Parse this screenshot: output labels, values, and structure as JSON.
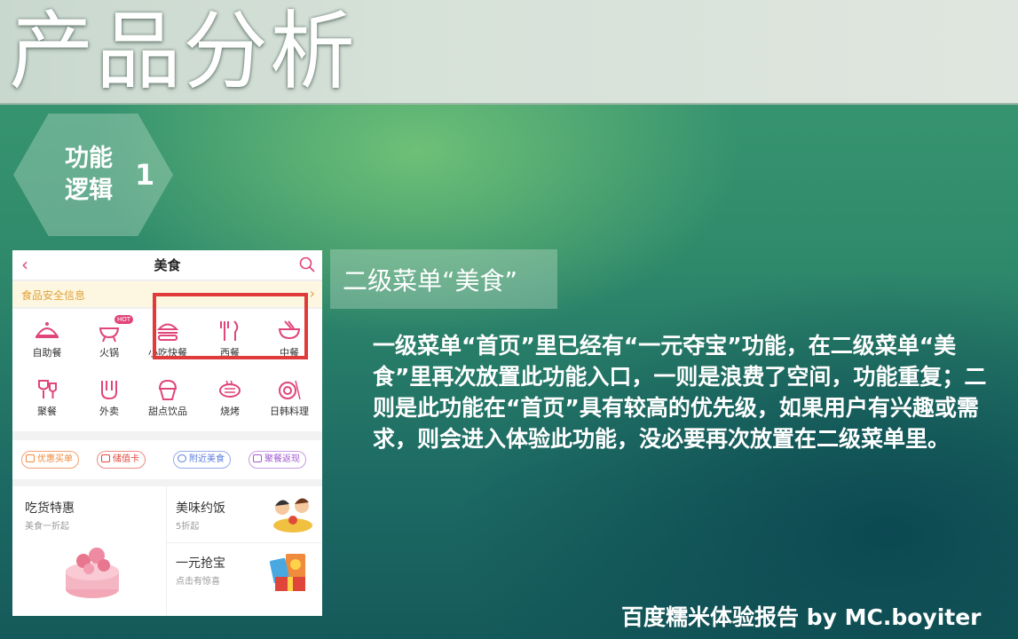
{
  "slide": {
    "title": "产品分析",
    "section_label": "功能逻辑",
    "section_number": "1",
    "subtitle": "二级菜单“美食”",
    "body": "一级菜单“首页”里已经有“一元夺宝”功能，在二级菜单“美食”里再次放置此功能入口，一则是浪费了空间，功能重复；二则是此功能在“首页”具有较高的优先级，如果用户有兴趣或需求，则会进入体验此功能，没必要再次放置在二级菜单里。",
    "footer": "百度糯米体验报告 by MC.boyiter"
  },
  "phone": {
    "header_title": "美食",
    "notice": "食品安全信息",
    "categories": [
      {
        "label": "自助餐",
        "icon": "buffet-icon"
      },
      {
        "label": "火锅",
        "icon": "hotpot-icon",
        "badge": "HOT"
      },
      {
        "label": "小吃快餐",
        "icon": "burger-icon"
      },
      {
        "label": "西餐",
        "icon": "cutlery-icon"
      },
      {
        "label": "中餐",
        "icon": "bowl-icon"
      },
      {
        "label": "聚餐",
        "icon": "wine-icon"
      },
      {
        "label": "外卖",
        "icon": "takeout-icon"
      },
      {
        "label": "甜点饮品",
        "icon": "cupcake-icon"
      },
      {
        "label": "烧烤",
        "icon": "grill-icon"
      },
      {
        "label": "日韩料理",
        "icon": "sushi-icon"
      }
    ],
    "tags": [
      {
        "label": "优惠买单",
        "color": "#f08a3c"
      },
      {
        "label": "储值卡",
        "color": "#e0453a"
      },
      {
        "label": "附近美食",
        "color": "#5a7be0"
      },
      {
        "label": "聚餐返现",
        "color": "#a35ad0"
      }
    ],
    "promos": {
      "left_title": "吃货特惠",
      "left_sub": "美食一折起",
      "top_right_title": "美味约饭",
      "top_right_sub": "5折起",
      "bottom_right_title": "一元抢宝",
      "bottom_right_sub": "点击有惊喜"
    },
    "accent": "#e0457b"
  }
}
